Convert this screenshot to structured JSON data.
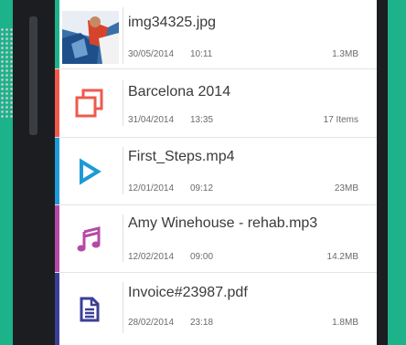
{
  "files": [
    {
      "name": "img34325.jpg",
      "date": "30/05/2014",
      "time": "10:11",
      "size": "1.3MB",
      "type": "image",
      "icon": "image-thumbnail",
      "color": "#1db38a"
    },
    {
      "name": "Barcelona 2014",
      "date": "31/04/2014",
      "time": "13:35",
      "size": "17 Items",
      "type": "folder",
      "icon": "folder-copy-icon",
      "color": "#ef5a4c"
    },
    {
      "name": "First_Steps.mp4",
      "date": "12/01/2014",
      "time": "09:12",
      "size": "23MB",
      "type": "video",
      "icon": "play-icon",
      "color": "#1e9ad6"
    },
    {
      "name": "Amy Winehouse - rehab.mp3",
      "date": "12/02/2014",
      "time": "09:00",
      "size": "14.2MB",
      "type": "audio",
      "icon": "music-note-icon",
      "color": "#b54aa6"
    },
    {
      "name": "Invoice#23987.pdf",
      "date": "28/02/2014",
      "time": "23:18",
      "size": "1.8MB",
      "type": "document",
      "icon": "document-icon",
      "color": "#3b3f97"
    }
  ],
  "colors": {
    "background_accent": "#1db38a",
    "phone_frame": "#1b1d21"
  }
}
